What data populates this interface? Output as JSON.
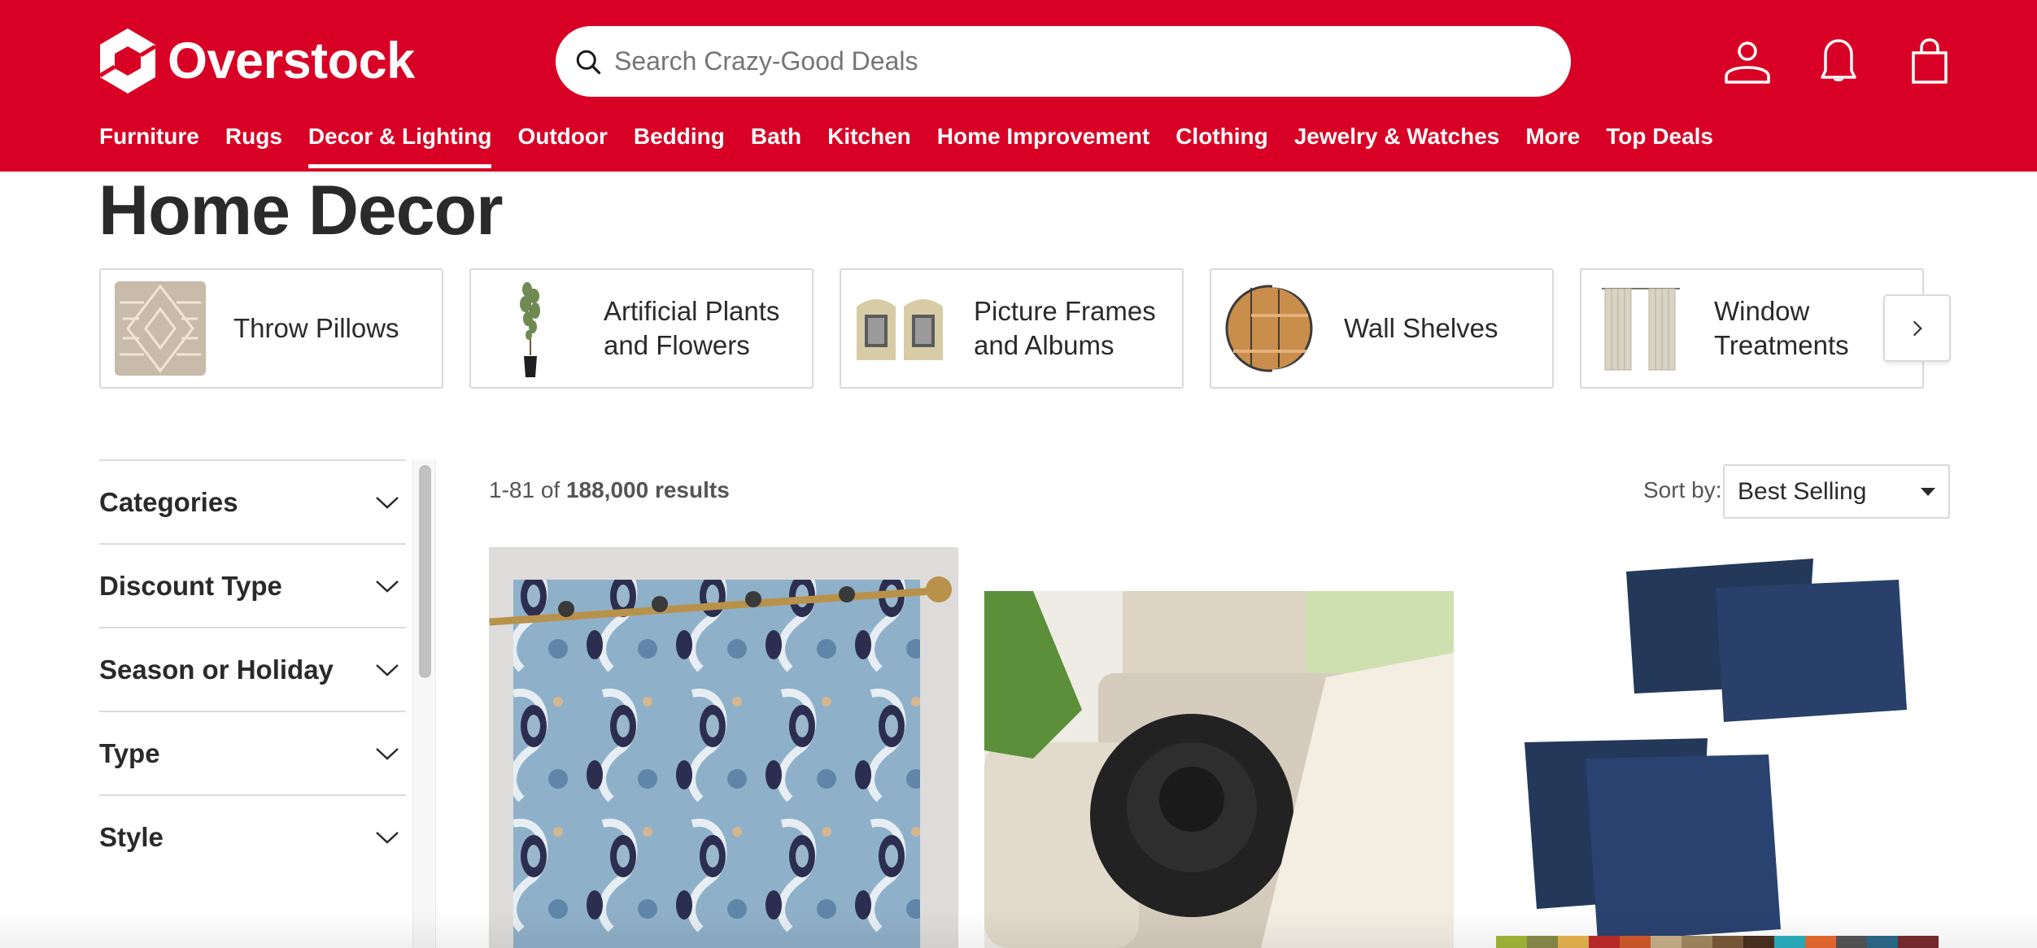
{
  "brand": {
    "name": "Overstock",
    "color": "#d80024"
  },
  "search": {
    "placeholder": "Search Crazy-Good Deals",
    "value": ""
  },
  "header_icons": [
    {
      "name": "account-icon",
      "label": "Account"
    },
    {
      "name": "notifications-icon",
      "label": "Notifications"
    },
    {
      "name": "cart-icon",
      "label": "Cart"
    }
  ],
  "nav": {
    "active_index": 2,
    "items": [
      {
        "label": "Furniture"
      },
      {
        "label": "Rugs"
      },
      {
        "label": "Decor & Lighting"
      },
      {
        "label": "Outdoor"
      },
      {
        "label": "Bedding"
      },
      {
        "label": "Bath"
      },
      {
        "label": "Kitchen"
      },
      {
        "label": "Home Improvement"
      },
      {
        "label": "Clothing"
      },
      {
        "label": "Jewelry & Watches"
      },
      {
        "label": "More"
      },
      {
        "label": "Top Deals"
      }
    ]
  },
  "page": {
    "title": "Home Decor"
  },
  "categories": [
    {
      "label": "Throw Pillows",
      "image": "throw-pillow"
    },
    {
      "label": "Artificial Plants and Flowers",
      "image": "potted-plant"
    },
    {
      "label": "Picture Frames and Albums",
      "image": "picture-frames"
    },
    {
      "label": "Wall Shelves",
      "image": "round-wall-shelf"
    },
    {
      "label": "Window Treatments",
      "image": "curtain-panels"
    }
  ],
  "categories_next_label": "Next",
  "filters": [
    {
      "label": "Categories",
      "expanded": false
    },
    {
      "label": "Discount Type",
      "expanded": false
    },
    {
      "label": "Season or Holiday",
      "expanded": false
    },
    {
      "label": "Type",
      "expanded": false
    },
    {
      "label": "Style",
      "expanded": false
    }
  ],
  "results": {
    "range": "1-81",
    "of": "of",
    "total": "188,000 results"
  },
  "sort": {
    "label": "Sort by:",
    "selected": "Best Selling"
  },
  "products": [
    {
      "image": "blue-paisley-grommet-curtain"
    },
    {
      "image": "black-felt-rose-pillow"
    },
    {
      "image": "navy-throw-pillow-set"
    }
  ]
}
